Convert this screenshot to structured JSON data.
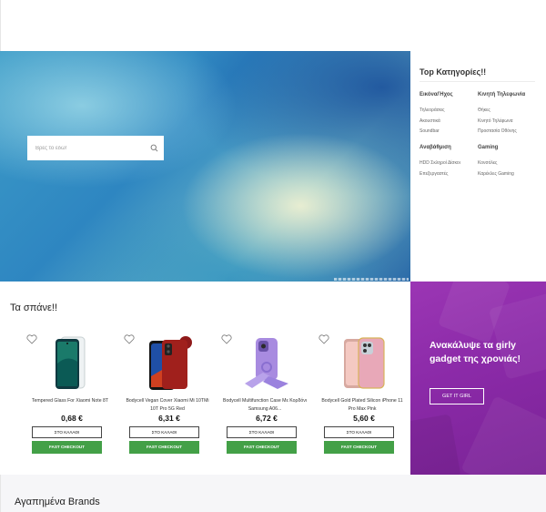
{
  "search": {
    "placeholder": "Βρες το εδώ!"
  },
  "categories": {
    "title": "Top Κατηγορίες!!",
    "columns": [
      {
        "heading": "Εικόνα/Ήχος",
        "items": [
          "Τηλεοράσεις",
          "Ακουστικά",
          "Soundbar"
        ]
      },
      {
        "heading": "Κινητή Τηλεφωνία",
        "items": [
          "Θήκες",
          "Κινητό Τηλέφωνα",
          "Προστασία Οθόνης"
        ]
      },
      {
        "heading": "Αναβάθμιση",
        "items": [
          "HDD Σκληροί Δίσκοι",
          "Επεξεργαστές"
        ]
      },
      {
        "heading": "Gaming",
        "items": [
          "Κονσόλες",
          "Καρέκλες Gaming"
        ]
      }
    ]
  },
  "deals": {
    "title": "Τα σπάνε!!",
    "products": [
      {
        "name": "Tempered Glass For Xiaomi Note 8T",
        "price": "0,68 €",
        "cart_label": "ΣΤΟ ΚΑΛΑΘΙ",
        "fast_label": "FAST CHECKOUT"
      },
      {
        "name": "Bodycell Vegan Cover Xiaomi Mi 10TMi 10T Pro 5G Red",
        "price": "6,31 €",
        "cart_label": "ΣΤΟ ΚΑΛΑΘΙ",
        "fast_label": "FAST CHECKOUT"
      },
      {
        "name": "Bodycell Multifunction Case Με Κορδόνι Samsung A06...",
        "price": "6,72 €",
        "cart_label": "ΣΤΟ ΚΑΛΑΘΙ",
        "fast_label": "FAST CHECKOUT"
      },
      {
        "name": "Bodycell Gold Plated Silicon iPhone 11 Pro Max Pink",
        "price": "5,60 €",
        "cart_label": "ΣΤΟ ΚΑΛΑΘΙ",
        "fast_label": "FAST CHECKOUT"
      }
    ]
  },
  "promo": {
    "text": "Ανακάλυψε τα girly gadget της χρονιάς!",
    "button_label": "GET IT GIRL"
  },
  "brands": {
    "title": "Αγαπημένα Brands"
  },
  "colors": {
    "accent_green": "#43a047",
    "promo_purple": "#8b2aa8"
  }
}
